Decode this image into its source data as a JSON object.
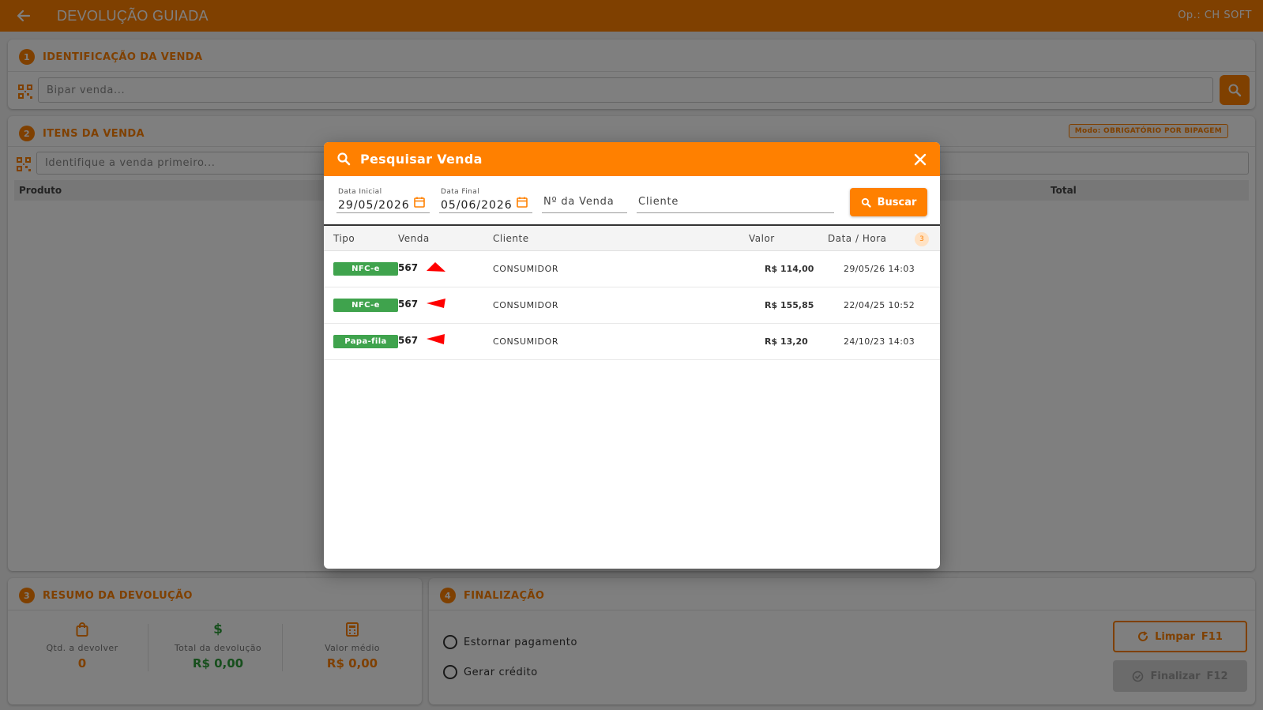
{
  "topbar": {
    "title": "DEVOLUÇÃO GUIADA",
    "operator": "Op.: CH SOFT",
    "back_icon": "arrow-left-icon"
  },
  "colors": {
    "accent": "#ff8000",
    "success": "#3fa34d",
    "arrow": "#ff0000"
  },
  "identificacao": {
    "step": "1",
    "title": "IDENTIFICAÇÃO DA VENDA",
    "placeholder": "Bipar venda..."
  },
  "itens": {
    "step": "2",
    "title": "ITENS DA VENDA",
    "mode": "Modo: OBRIGATÓRIO POR BIPAGEM",
    "placeholder": "Identifique a venda primeiro...",
    "columns": {
      "produto": "Produto",
      "total": "Total"
    }
  },
  "resumo": {
    "step": "3",
    "title": "RESUMO DA DEVOLUÇÃO",
    "qtd_label": "Qtd. a devolver",
    "qtd_value": "0",
    "total_label": "Total da devolução",
    "total_value": "R$ 0,00",
    "medio_label": "Valor médio",
    "medio_value": "R$ 0,00"
  },
  "finalizacao": {
    "step": "4",
    "title": "FINALIZAÇÃO",
    "option1": "Estornar pagamento",
    "option2": "Gerar crédito",
    "limpar": "Limpar",
    "limpar_key": "F11",
    "finalizar": "Finalizar",
    "finalizar_key": "F12"
  },
  "modal": {
    "title": "Pesquisar Venda",
    "data_inicial_label": "Data Inicial",
    "data_inicial_value": "29/05/2026",
    "data_final_label": "Data Final",
    "data_final_value": "05/06/2026",
    "numero_placeholder": "Nº da Venda",
    "cliente_placeholder": "Cliente",
    "buscar": "Buscar",
    "columns": {
      "tipo": "Tipo",
      "venda": "Venda",
      "cliente": "Cliente",
      "valor": "Valor",
      "datahora": "Data / Hora"
    },
    "count": "3",
    "rows": [
      {
        "tipo": "NFC-e",
        "venda": "567",
        "cliente": "CONSUMIDOR",
        "valor": "R$ 114,00",
        "datahora": "29/05/26 14:03"
      },
      {
        "tipo": "NFC-e",
        "venda": "567",
        "cliente": "CONSUMIDOR",
        "valor": "R$ 155,85",
        "datahora": "22/04/25 10:52"
      },
      {
        "tipo": "Papa-fila",
        "venda": "567",
        "cliente": "CONSUMIDOR",
        "valor": "R$ 13,20",
        "datahora": "24/10/23 14:03"
      }
    ]
  }
}
